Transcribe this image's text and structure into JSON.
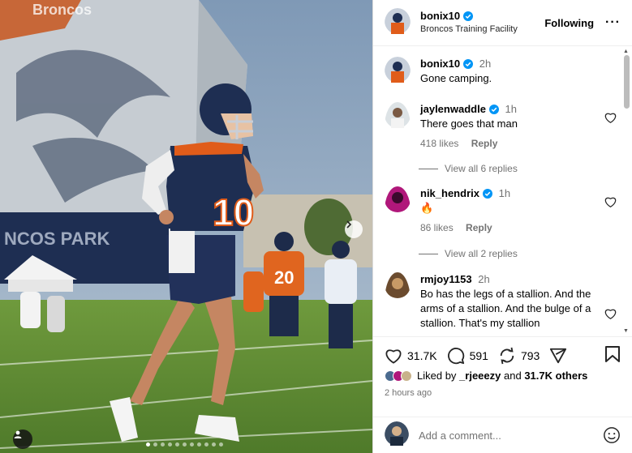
{
  "post": {
    "author": "bonix10",
    "location": "Broncos Training Facility",
    "follow_label": "Following",
    "more_label": "···",
    "jersey_number": "10",
    "photo_dots": {
      "count": 11,
      "active_index": 0
    }
  },
  "caption": {
    "user": "bonix10",
    "time": "2h",
    "text": "Gone camping."
  },
  "comments": [
    {
      "user": "jaylenwaddle",
      "time": "1h",
      "text": "There goes that man",
      "likes": "418 likes",
      "reply": "Reply",
      "view_replies": "View all 6 replies"
    },
    {
      "user": "nik_hendrix",
      "time": "1h",
      "text": "🔥",
      "likes": "86 likes",
      "reply": "Reply",
      "view_replies": "View all 2 replies"
    },
    {
      "user": "rmjoy1153",
      "time": "2h",
      "text": "Bo has the legs of a stallion. And the arms of a stallion. And the bulge of a stallion. That's my stallion"
    }
  ],
  "actions": {
    "likes": "31.7K",
    "comments": "591",
    "reposts": "793"
  },
  "liked_by": {
    "prefix": "Liked by",
    "user": "_rjeeezy",
    "middle": "and",
    "others": "31.7K others"
  },
  "time_ago": "2 hours ago",
  "add_comment": {
    "placeholder": "Add a comment..."
  },
  "colors": {
    "verified": "#0095f6",
    "broncos_navy": "#1c2a48",
    "broncos_orange": "#e05c1a"
  },
  "icons": [
    "verified-icon",
    "heart-icon",
    "comment-icon",
    "repost-icon",
    "share-icon",
    "bookmark-icon",
    "emoji-icon",
    "next-arrow-icon",
    "user-tag-icon"
  ]
}
